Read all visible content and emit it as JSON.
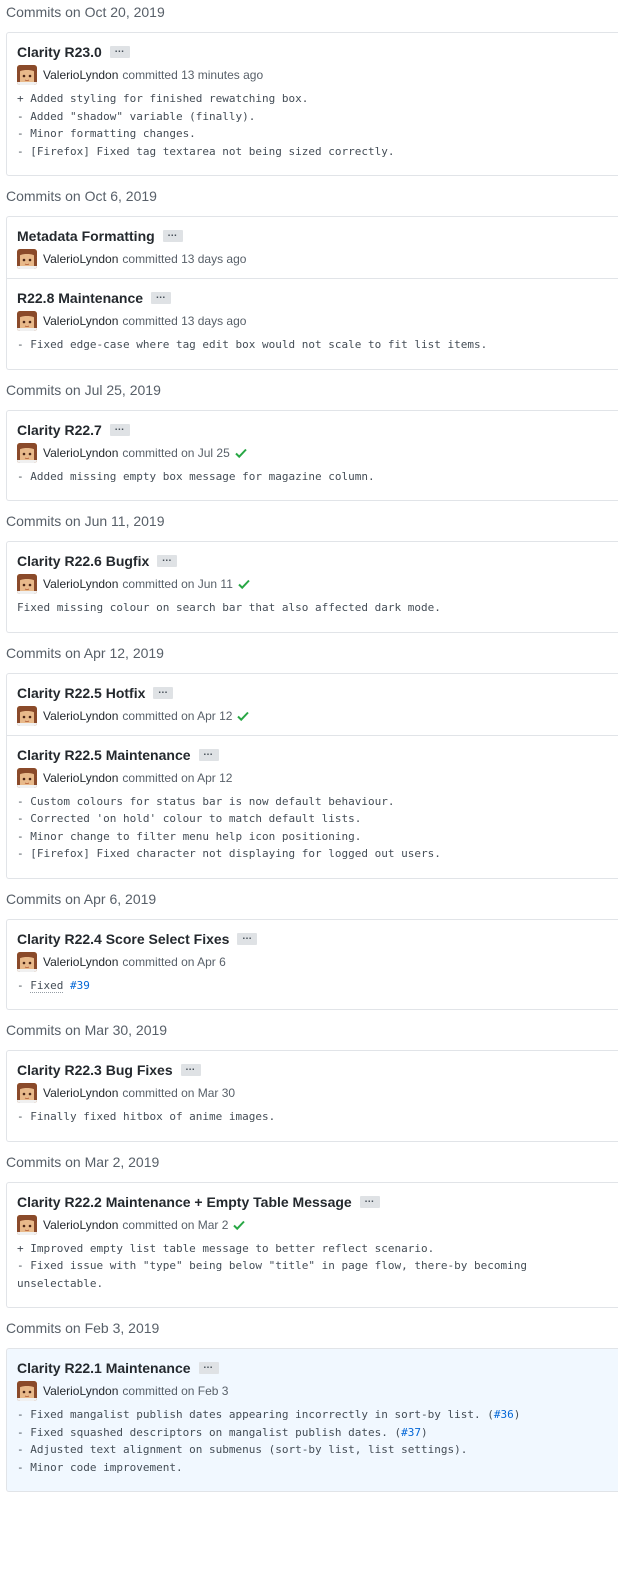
{
  "colors": {
    "link": "#0366d6",
    "check": "#28a745",
    "ellipsis_bg": "#dfe2e5",
    "highlight_bg": "#f1f8ff"
  },
  "ellipsis_label": "…",
  "groups": [
    {
      "header": "Commits on Oct 20, 2019",
      "commits": [
        {
          "title": "Clarity R23.0",
          "author": "ValerioLyndon",
          "meta": "committed 13 minutes ago",
          "verified": false,
          "description": [
            "+ Added styling for finished rewatching box.",
            "- Added \"shadow\" variable (finally).",
            "- Minor formatting changes.",
            "- [Firefox] Fixed tag textarea not being sized correctly."
          ]
        }
      ]
    },
    {
      "header": "Commits on Oct 6, 2019",
      "commits": [
        {
          "title": "Metadata Formatting",
          "author": "ValerioLyndon",
          "meta": "committed 13 days ago",
          "verified": false,
          "description": []
        },
        {
          "title": "R22.8 Maintenance",
          "author": "ValerioLyndon",
          "meta": "committed 13 days ago",
          "verified": false,
          "description": [
            "- Fixed edge-case where tag edit box would not scale to fit list items."
          ]
        }
      ]
    },
    {
      "header": "Commits on Jul 25, 2019",
      "commits": [
        {
          "title": "Clarity R22.7",
          "author": "ValerioLyndon",
          "meta": "committed on Jul 25",
          "verified": true,
          "description": [
            "- Added missing empty box message for magazine column."
          ]
        }
      ]
    },
    {
      "header": "Commits on Jun 11, 2019",
      "commits": [
        {
          "title": "Clarity R22.6 Bugfix",
          "author": "ValerioLyndon",
          "meta": "committed on Jun 11",
          "verified": true,
          "description": [
            "Fixed missing colour on search bar that also affected dark mode."
          ]
        }
      ]
    },
    {
      "header": "Commits on Apr 12, 2019",
      "commits": [
        {
          "title": "Clarity R22.5 Hotfix",
          "author": "ValerioLyndon",
          "meta": "committed on Apr 12",
          "verified": true,
          "description": []
        },
        {
          "title": "Clarity R22.5 Maintenance",
          "author": "ValerioLyndon",
          "meta": "committed on Apr 12",
          "verified": false,
          "description": [
            "- Custom colours for status bar is now default behaviour.",
            "- Corrected 'on hold' colour to match default lists.",
            "- Minor change to filter menu help icon positioning.",
            "- [Firefox] Fixed character not displaying for logged out users."
          ]
        }
      ]
    },
    {
      "header": "Commits on Apr 6, 2019",
      "commits": [
        {
          "title": "Clarity R22.4 Score Select Fixes",
          "author": "ValerioLyndon",
          "meta": "committed on Apr 6",
          "verified": false,
          "description_parts": [
            {
              "text": "- "
            },
            {
              "text": "Fixed",
              "style": "dotted"
            },
            {
              "text": " "
            },
            {
              "text": "#39",
              "style": "link"
            }
          ]
        }
      ]
    },
    {
      "header": "Commits on Mar 30, 2019",
      "commits": [
        {
          "title": "Clarity R22.3 Bug Fixes",
          "author": "ValerioLyndon",
          "meta": "committed on Mar 30",
          "verified": false,
          "description": [
            "- Finally fixed hitbox of anime images."
          ]
        }
      ]
    },
    {
      "header": "Commits on Mar 2, 2019",
      "commits": [
        {
          "title": "Clarity R22.2 Maintenance + Empty Table Message",
          "author": "ValerioLyndon",
          "meta": "committed on Mar 2",
          "verified": true,
          "description": [
            "+ Improved empty list table message to better reflect scenario.",
            "- Fixed issue with \"type\" being below \"title\" in page flow, there-by becoming",
            "unselectable."
          ]
        }
      ]
    },
    {
      "header": "Commits on Feb 3, 2019",
      "highlight": true,
      "commits": [
        {
          "title": "Clarity R22.1 Maintenance",
          "author": "ValerioLyndon",
          "meta": "committed on Feb 3",
          "verified": false,
          "description_lines": [
            [
              {
                "text": "- Fixed mangalist publish dates appearing incorrectly in sort-by list. ("
              },
              {
                "text": "#36",
                "style": "link"
              },
              {
                "text": ")"
              }
            ],
            [
              {
                "text": "- Fixed squashed descriptors on mangalist publish dates. ("
              },
              {
                "text": "#37",
                "style": "link"
              },
              {
                "text": ")"
              }
            ],
            [
              {
                "text": "- Adjusted text alignment on submenus (sort-by list, list settings)."
              }
            ],
            [
              {
                "text": "- Minor code improvement."
              }
            ]
          ]
        }
      ]
    }
  ]
}
